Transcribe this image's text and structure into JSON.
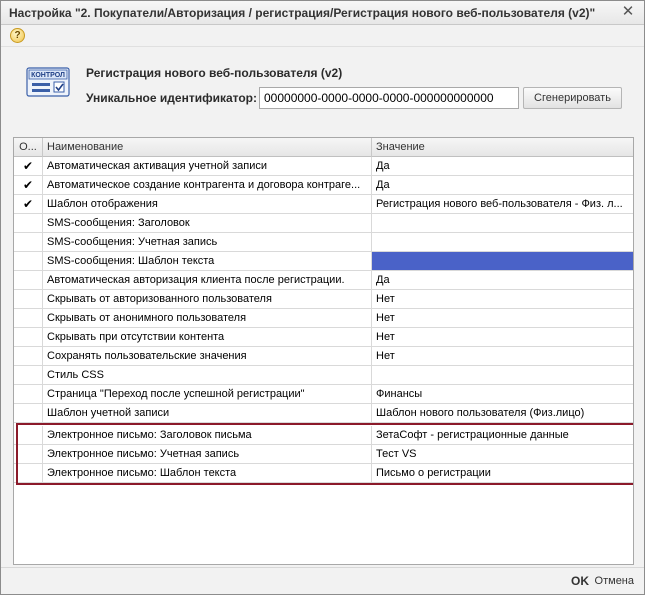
{
  "window": {
    "title": "Настройка \"2. Покупатели/Авторизация / регистрация/Регистрация нового веб-пользователя (v2)\"",
    "close_glyph": "✕",
    "help_glyph": "?"
  },
  "form": {
    "icon_label": "КОНТРОЛ",
    "title": "Регистрация нового веб-пользователя (v2)",
    "uid_label": "Уникальное идентификатор:",
    "uid_value": "00000000-0000-0000-0000-000000000000",
    "generate_label": "Сгенерировать"
  },
  "grid": {
    "headers": [
      "О...",
      "Наименование",
      "Значение"
    ],
    "rows": [
      {
        "check": "✔",
        "name": "Автоматическая активация учетной записи",
        "value": "Да"
      },
      {
        "check": "✔",
        "name": "Автоматическое создание контрагента и договора контраге...",
        "value": "Да"
      },
      {
        "check": "✔",
        "name": "Шаблон отображения",
        "value": "Регистрация нового веб-пользователя - Физ. л..."
      },
      {
        "check": "",
        "name": "SMS-сообщения: Заголовок",
        "value": ""
      },
      {
        "check": "",
        "name": "SMS-сообщения: Учетная запись",
        "value": ""
      },
      {
        "check": "",
        "name": "SMS-сообщения: Шаблон текста",
        "value": ""
      },
      {
        "check": "",
        "name": "Автоматическая авторизация клиента после регистрации.",
        "value": "Да"
      },
      {
        "check": "",
        "name": "Скрывать от авторизованного пользователя",
        "value": "Нет"
      },
      {
        "check": "",
        "name": "Скрывать от анонимного пользователя",
        "value": "Нет"
      },
      {
        "check": "",
        "name": "Скрывать при отсутствии контента",
        "value": "Нет"
      },
      {
        "check": "",
        "name": "Сохранять пользовательские значения",
        "value": "Нет"
      },
      {
        "check": "",
        "name": "Стиль CSS",
        "value": ""
      },
      {
        "check": "",
        "name": "Страница \"Переход после успешной регистрации\"",
        "value": "Финансы"
      },
      {
        "check": "",
        "name": "Шаблон учетной записи",
        "value": "Шаблон нового пользователя (Физ.лицо)"
      },
      {
        "check": "",
        "name": "Электронное письмо: Заголовок письма",
        "value": "ЗетаСофт - регистрационные данные"
      },
      {
        "check": "",
        "name": "Электронное письмо: Учетная запись",
        "value": "Тест VS"
      },
      {
        "check": "",
        "name": "Электронное письмо: Шаблон текста",
        "value": "Письмо о регистрации"
      }
    ]
  },
  "footer": {
    "ok_label": "OK",
    "cancel_label": "Отмена"
  },
  "colors": {
    "selected_cell": "#4a62c8",
    "highlight_border": "#8b1a2a"
  }
}
